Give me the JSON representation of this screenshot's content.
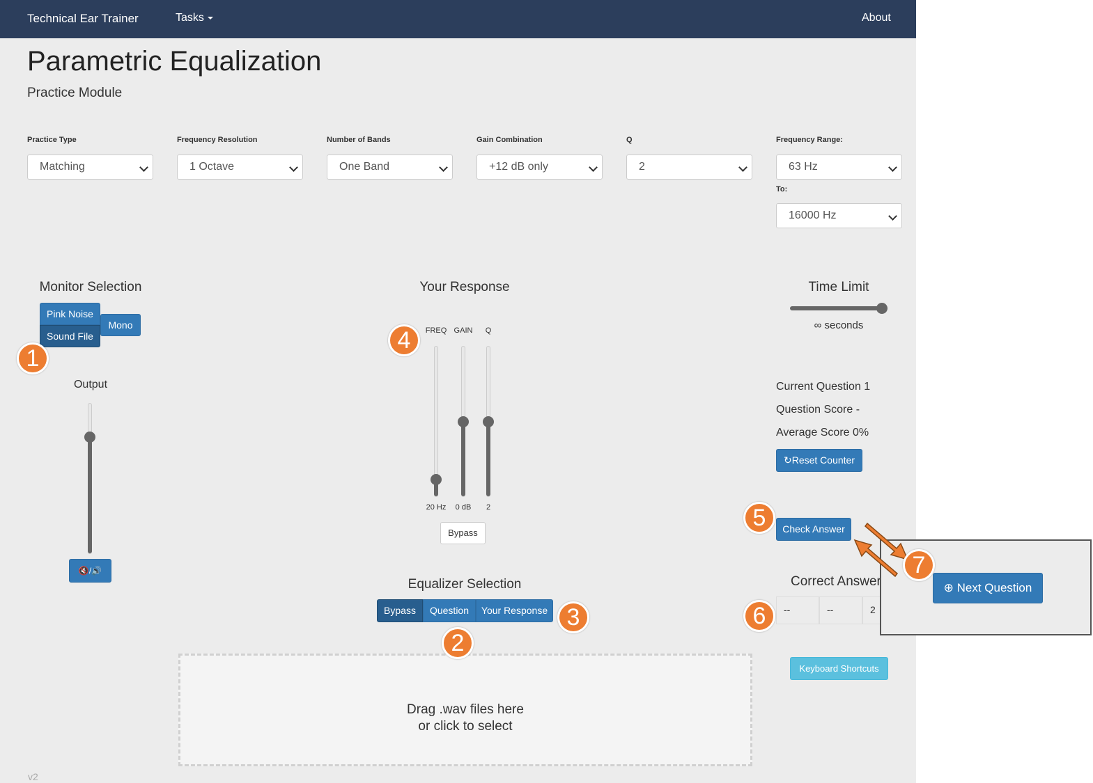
{
  "navbar": {
    "brand": "Technical Ear Trainer",
    "tasks": "Tasks",
    "about": "About"
  },
  "page": {
    "title": "Parametric Equalization",
    "subtitle": "Practice Module",
    "version": "v2"
  },
  "controls": {
    "practice_type": {
      "label": "Practice Type",
      "value": "Matching"
    },
    "frequency_resolution": {
      "label": "Frequency Resolution",
      "value": "1 Octave"
    },
    "number_of_bands": {
      "label": "Number of Bands",
      "value": "One Band"
    },
    "gain_combination": {
      "label": "Gain Combination",
      "value": "+12 dB only"
    },
    "q": {
      "label": "Q",
      "value": "2"
    },
    "frequency_range": {
      "label": "Frequency Range:",
      "from": "63 Hz",
      "to_label": "To:",
      "to": "16000 Hz"
    }
  },
  "monitor": {
    "title": "Monitor Selection",
    "pink_noise": "Pink Noise",
    "sound_file": "Sound File",
    "mono": "Mono",
    "output_label": "Output",
    "output_level": 0.8,
    "mute_toggle": "🔇/🔊"
  },
  "response": {
    "title": "Your Response",
    "sliders": [
      {
        "name": "FREQ",
        "value": "20 Hz",
        "level": 0.08
      },
      {
        "name": "GAIN",
        "value": "0 dB",
        "level": 0.5
      },
      {
        "name": "Q",
        "value": "2",
        "level": 0.5
      }
    ],
    "bypass": "Bypass"
  },
  "equalizer": {
    "title": "Equalizer Selection",
    "options": [
      "Bypass",
      "Question",
      "Your Response"
    ],
    "selected": "Bypass"
  },
  "dropzone": {
    "line1": "Drag .wav files here",
    "line2": "or click to select"
  },
  "time_limit": {
    "title": "Time Limit",
    "value": "∞ seconds",
    "level": 1.0
  },
  "score": {
    "current_question": "Current Question 1",
    "question_score": "Question Score -",
    "average_score": "Average Score 0%",
    "reset": "Reset Counter"
  },
  "check_answer": "Check Answer",
  "correct_answer": {
    "title": "Correct Answer",
    "cells": [
      "--",
      "--",
      "2"
    ]
  },
  "keyboard_shortcuts": "Keyboard Shortcuts",
  "next_question": "Next Question",
  "annotations": [
    "1",
    "2",
    "3",
    "4",
    "5",
    "6",
    "7"
  ],
  "colors": {
    "navbar": "#2c3e5c",
    "primary": "#337ab7",
    "info": "#5bc0de",
    "badge": "#ed7d31",
    "background": "#ececec"
  }
}
